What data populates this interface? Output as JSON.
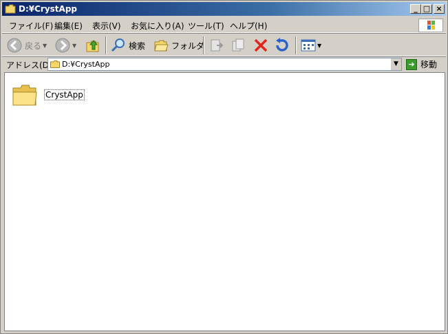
{
  "window": {
    "title": "D:¥CrystApp"
  },
  "caption_buttons": {
    "minimize": "_",
    "maximize": "□",
    "close": "×"
  },
  "menu": [
    {
      "label": "ファイル(F)"
    },
    {
      "label": "編集(E)"
    },
    {
      "label": "表示(V)"
    },
    {
      "label": "お気に入り(A)"
    },
    {
      "label": "ツール(T)"
    },
    {
      "label": "ヘルプ(H)"
    }
  ],
  "toolbar": {
    "back_label": "戻る",
    "search_label": "検索",
    "folders_label": "フォルダ"
  },
  "address": {
    "label": "アドレス(D)",
    "value": "D:¥CrystApp",
    "go_label": "移動"
  },
  "items": [
    {
      "label": "CrystApp",
      "icon": "folder-icon"
    }
  ],
  "colors": {
    "titlebar_start": "#0a246a",
    "titlebar_end": "#a6caf0",
    "chrome": "#d4d0c8"
  }
}
